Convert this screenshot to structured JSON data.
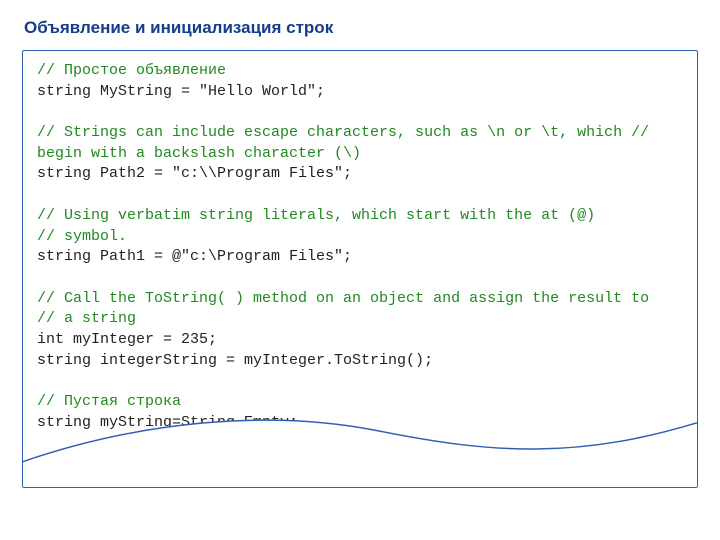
{
  "title": "Объявление и инициализация строк",
  "code": {
    "c1": "// Простое объявление",
    "l1": "string MyString = \"Hello World\";",
    "blank1": "",
    "c2a": "// Strings can include escape characters, such as \\n or \\t, which //",
    "c2b": "begin with a backslash character (\\)",
    "l2": "string Path2 = \"c:\\\\Program Files\";",
    "blank2": "",
    "c3a": "// Using verbatim string literals, which start with the at (@)",
    "c3b": "// symbol.",
    "l3": "string Path1 = @\"c:\\Program Files\";",
    "blank3": "",
    "c4a": "// Call the ToString( ) method on an object and assign the result to",
    "c4b": "// a string",
    "l4a": "int myInteger = 235;",
    "l4b": "string integerString = myInteger.ToString();",
    "blank4": "",
    "c5": "// Пустая строка",
    "l5": "string myString=String.Empty;"
  }
}
